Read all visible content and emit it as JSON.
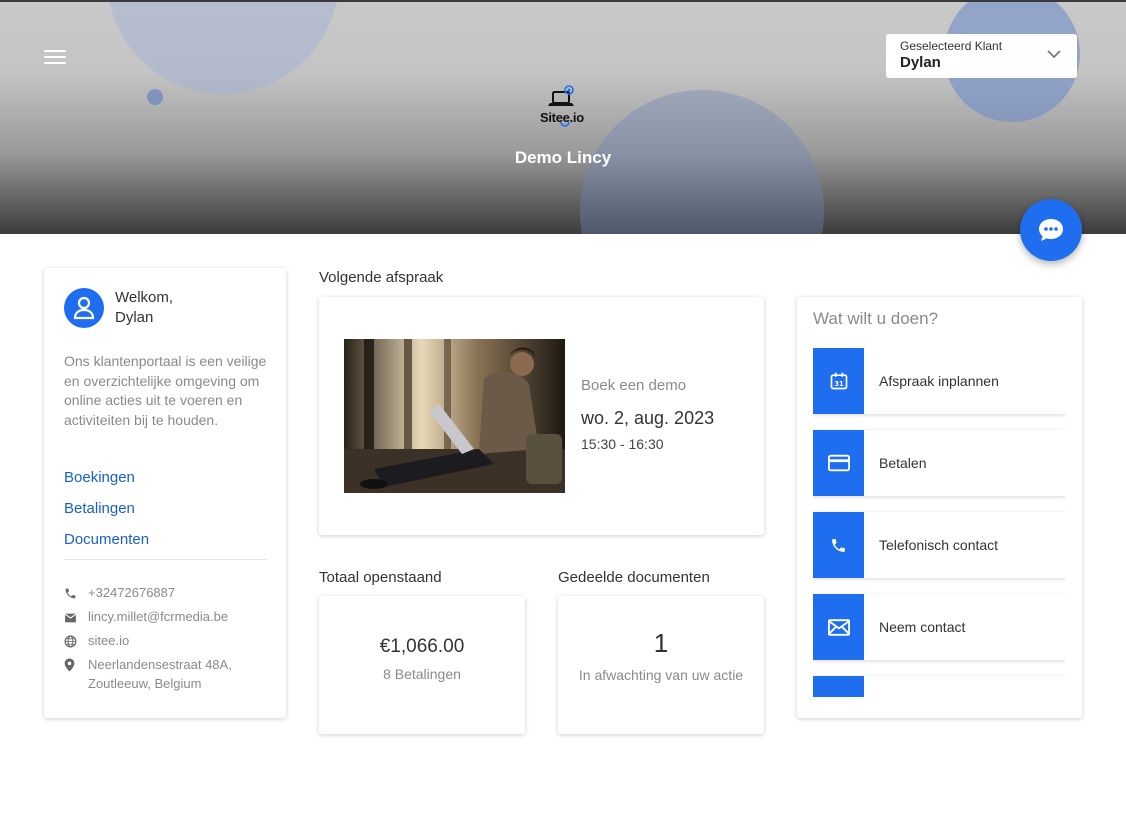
{
  "header": {
    "logo_text": "Sitee.io",
    "title": "Demo Lincy",
    "client_select": {
      "label": "Geselecteerd Klant",
      "value": "Dylan"
    }
  },
  "welcome": {
    "greeting": "Welkom,",
    "name": "Dylan",
    "intro": "Ons klantenportaal is een veilige en overzichtelijke omgeving om online acties uit te voeren en activiteiten bij te houden.",
    "links": [
      "Boekingen",
      "Betalingen",
      "Documenten"
    ],
    "contact": {
      "phone": "+32472676887",
      "email": "lincy.millet@fcrmedia.be",
      "website": "sitee.io",
      "address_line1": "Neerlandensestraat 48A,",
      "address_line2": "Zoutleeuw, Belgium"
    }
  },
  "appointment": {
    "section_label": "Volgende afspraak",
    "type": "Boek een demo",
    "date": "wo. 2, aug. 2023",
    "time": "15:30 - 16:30"
  },
  "totals": {
    "section_label": "Totaal openstaand",
    "amount": "€1,066.00",
    "sub": "8 Betalingen"
  },
  "documents": {
    "section_label": "Gedeelde documenten",
    "count": "1",
    "sub": "In afwachting van uw actie"
  },
  "actions": {
    "title": "Wat wilt u doen?",
    "items": [
      {
        "label": "Afspraak inplannen",
        "icon": "calendar-icon"
      },
      {
        "label": "Betalen",
        "icon": "credit-card-icon"
      },
      {
        "label": "Telefonisch contact",
        "icon": "phone-icon"
      },
      {
        "label": "Neem contact",
        "icon": "mail-icon"
      },
      {
        "label": "",
        "icon": ""
      }
    ]
  },
  "colors": {
    "accent": "#1f6ef0",
    "link": "#1a5fd0",
    "muted": "#8a8a8a"
  }
}
